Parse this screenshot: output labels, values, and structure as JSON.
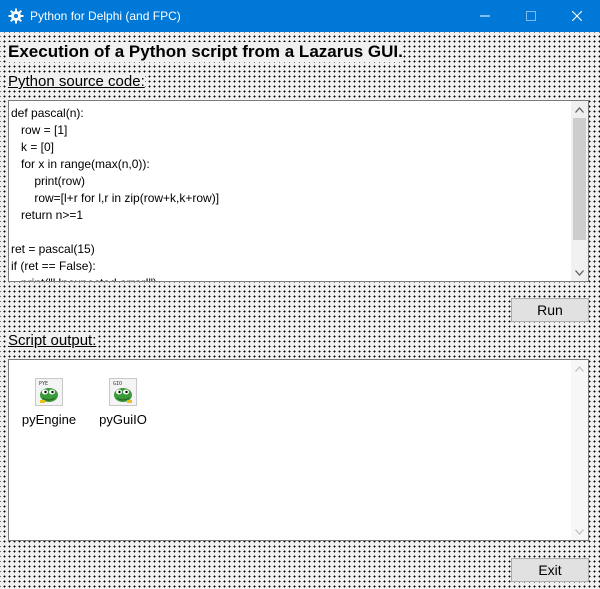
{
  "window": {
    "title": "Python for Delphi (and FPC)",
    "icon": "gear-icon"
  },
  "form": {
    "heading": "Execution of a Python script from a Lazarus GUI.",
    "source_label": "Python source code:",
    "output_label": "Script output:",
    "source_code": "def pascal(n):\n   row = [1]\n   k = [0]\n   for x in range(max(n,0)):\n       print(row)\n       row=[l+r for l,r in zip(row+k,k+row)]\n   return n>=1\n\nret = pascal(15)\nif (ret == False):\n   print(\"Unexpected error!\")",
    "run_label": "Run",
    "exit_label": "Exit",
    "components": [
      {
        "label": "pyEngine",
        "icon": "python-engine-icon"
      },
      {
        "label": "pyGuiIO",
        "icon": "python-guiio-icon"
      }
    ]
  },
  "colors": {
    "titlebar": "#0078d7",
    "form_background": "#f0f0f0",
    "dot_grid": "#000000"
  }
}
